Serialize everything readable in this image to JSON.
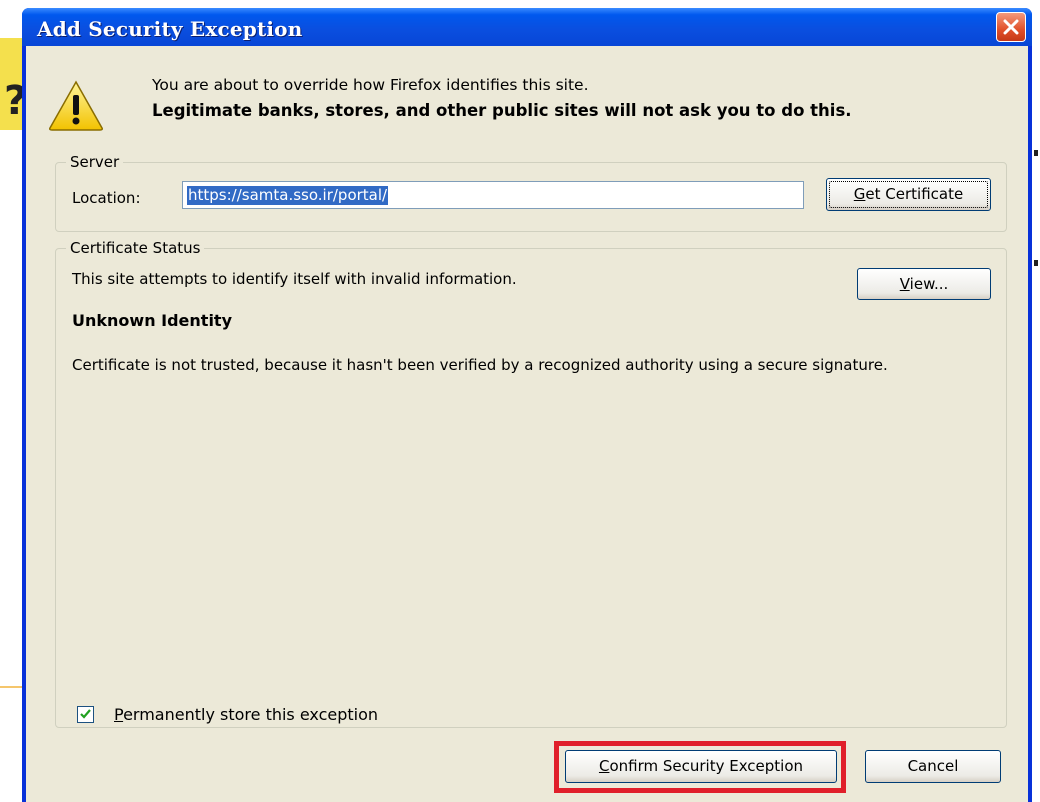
{
  "window": {
    "title": "Add Security Exception",
    "close_icon": "close-icon"
  },
  "warning": {
    "icon": "warning-icon",
    "line1": "You are about to override how Firefox identifies this site.",
    "line2": "Legitimate banks, stores, and other public sites will not ask you to do this."
  },
  "server": {
    "legend": "Server",
    "location_label": "Location:",
    "location_value": "https://samta.sso.ir/portal/",
    "get_certificate_label_pre": "",
    "get_certificate_label_key": "G",
    "get_certificate_label_post": "et Certificate"
  },
  "status": {
    "legend": "Certificate Status",
    "message": "This site attempts to identify itself with invalid information.",
    "view_label_key": "V",
    "view_label_post": "iew...",
    "identity_title": "Unknown Identity",
    "description": "Certificate is not trusted, because it hasn't been verified by a recognized authority using a secure signature."
  },
  "permanent": {
    "checked": true,
    "label_key": "P",
    "label_post": "ermanently store this exception"
  },
  "buttons": {
    "confirm_key": "C",
    "confirm_post": "onfirm Security Exception",
    "cancel": "Cancel"
  },
  "colors": {
    "titlebar": "#0a4fe0",
    "dialog_bg": "#ece9d8",
    "highlight": "#316ac5",
    "annotation_red": "#e01f2a"
  }
}
